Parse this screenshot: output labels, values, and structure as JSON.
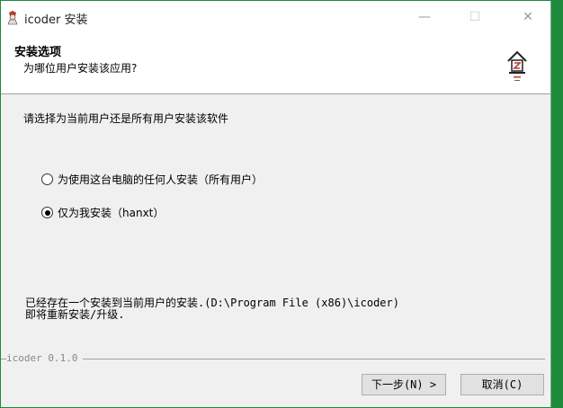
{
  "window": {
    "title": "icoder 安装",
    "minimize_glyph": "—",
    "maximize_glyph": "☐",
    "close_glyph": "✕"
  },
  "header": {
    "title": "安装选项",
    "subtitle": "为哪位用户安装该应用?"
  },
  "body": {
    "prompt": "请选择为当前用户还是所有用户安装该软件",
    "options": [
      {
        "label": "为使用这台电脑的任何人安装（所有用户）",
        "selected": false
      },
      {
        "label": "仅为我安装（hanxt）",
        "selected": true
      }
    ],
    "info_line1": "已经存在一个安装到当前用户的安装.(D:\\Program File (x86)\\icoder)",
    "info_line2": "即将重新安装/升级."
  },
  "footer": {
    "version": "icoder 0.1.0",
    "next_label": "下一步(N) >",
    "cancel_label": "取消(C)"
  },
  "colors": {
    "desktop": "#1e8a3c",
    "window_bg": "#f0f0f0"
  }
}
